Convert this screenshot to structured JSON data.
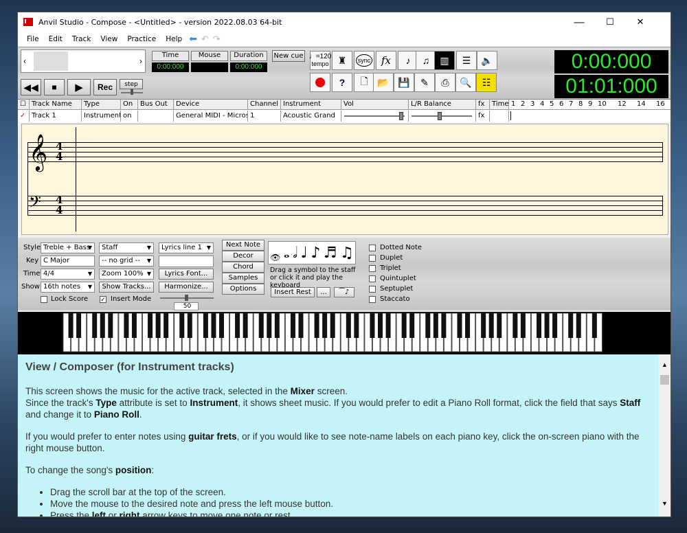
{
  "window": {
    "title": "Anvil Studio - Compose - <Untitled> - version 2022.08.03 64-bit",
    "min": "—",
    "max": "☐",
    "close": "✕"
  },
  "menu": [
    "File",
    "Edit",
    "Track",
    "View",
    "Practice",
    "Help"
  ],
  "toolbar": {
    "time_label": "Time",
    "mouse_label": "Mouse",
    "duration_label": "Duration",
    "time_value": "0:00:000",
    "mouse_value": "",
    "duration_value": "0:00:000",
    "new_cue": "New cue",
    "rec": "Rec",
    "step": "step",
    "tempo": "♩=120",
    "tempo_sub": "tempo",
    "sync": "sync",
    "fx": "fx",
    "clock_elapsed": "0:00:000",
    "clock_position": "01:01:000"
  },
  "track_header": {
    "columns": [
      "Track Name",
      "Type",
      "On",
      "Bus Out",
      "Device",
      "Channel",
      "Instrument",
      "Vol",
      "L/R Balance",
      "fx",
      "Time"
    ],
    "measures": [
      "1",
      "2",
      "3",
      "4",
      "5",
      "6",
      "7",
      "8",
      "9",
      "10",
      "12",
      "14",
      "16"
    ],
    "row": {
      "name": "Track 1",
      "type": "Instrument",
      "on": "on",
      "bus_out": "",
      "device": "General MIDI - Microso",
      "channel": "1",
      "instrument": "Acoustic Grand",
      "fx": "fx"
    }
  },
  "score": {
    "time_sig_top": "4",
    "time_sig_bottom": "4",
    "treble_clef": "𝄞",
    "bass_clef": "𝄢"
  },
  "controls": {
    "style_label": "Style",
    "style_value": "Treble + Bass",
    "key_label": "Key",
    "key_value": "C Major",
    "time_label": "Time",
    "time_value": "4/4",
    "show_label": "Show",
    "show_value": "16th notes",
    "view_value": "Staff",
    "grid_value": "-- no grid --",
    "zoom_value": "Zoom 100%",
    "show_tracks": "Show Tracks...",
    "lyrics_value": "Lyrics line 1",
    "lyrics_font": "Lyrics Font...",
    "harmonize": "Harmonize...",
    "lock_score": "Lock Score",
    "insert_mode": "Insert Mode",
    "slider_value": "50",
    "tabs": [
      "Next Note",
      "Decor",
      "Chord",
      "Samples",
      "Options"
    ],
    "drag_hint": "Drag a symbol to the staff or click it and play the keyboard",
    "insert_rest": "Insert Rest",
    "more": "...",
    "options": [
      "Dotted Note",
      "Duplet",
      "Triplet",
      "Quintuplet",
      "Septuplet",
      "Staccato"
    ]
  },
  "help": {
    "heading": "View / Composer (for Instrument tracks)",
    "p1a": "This screen shows the music for the active track, selected in the ",
    "p1b": "Mixer",
    "p1c": " screen.",
    "p2a": "Since the track's ",
    "p2b": "Type",
    "p2c": " attribute is set to ",
    "p2d": "Instrument",
    "p2e": ", it shows sheet music. If you would prefer to edit a Piano Roll format, click the field that says ",
    "p2f": "Staff",
    "p2g": " and change it to ",
    "p2h": "Piano Roll",
    "p2i": ".",
    "p3a": "If you would prefer to enter notes using ",
    "p3b": "guitar frets",
    "p3c": ", or if you would like to see note-name labels on each piano key, click the on-screen piano with the right mouse button.",
    "p4a": "To change the song's ",
    "p4b": "position",
    "p4c": ":",
    "li1": "Drag the scroll bar at the top of the screen.",
    "li2": "Move the mouse to the desired note and press the left mouse button.",
    "li3a": "Press the ",
    "li3b": "left",
    "li3c": " or ",
    "li3d": "right",
    "li3e": " arrow keys to move one note or rest."
  }
}
